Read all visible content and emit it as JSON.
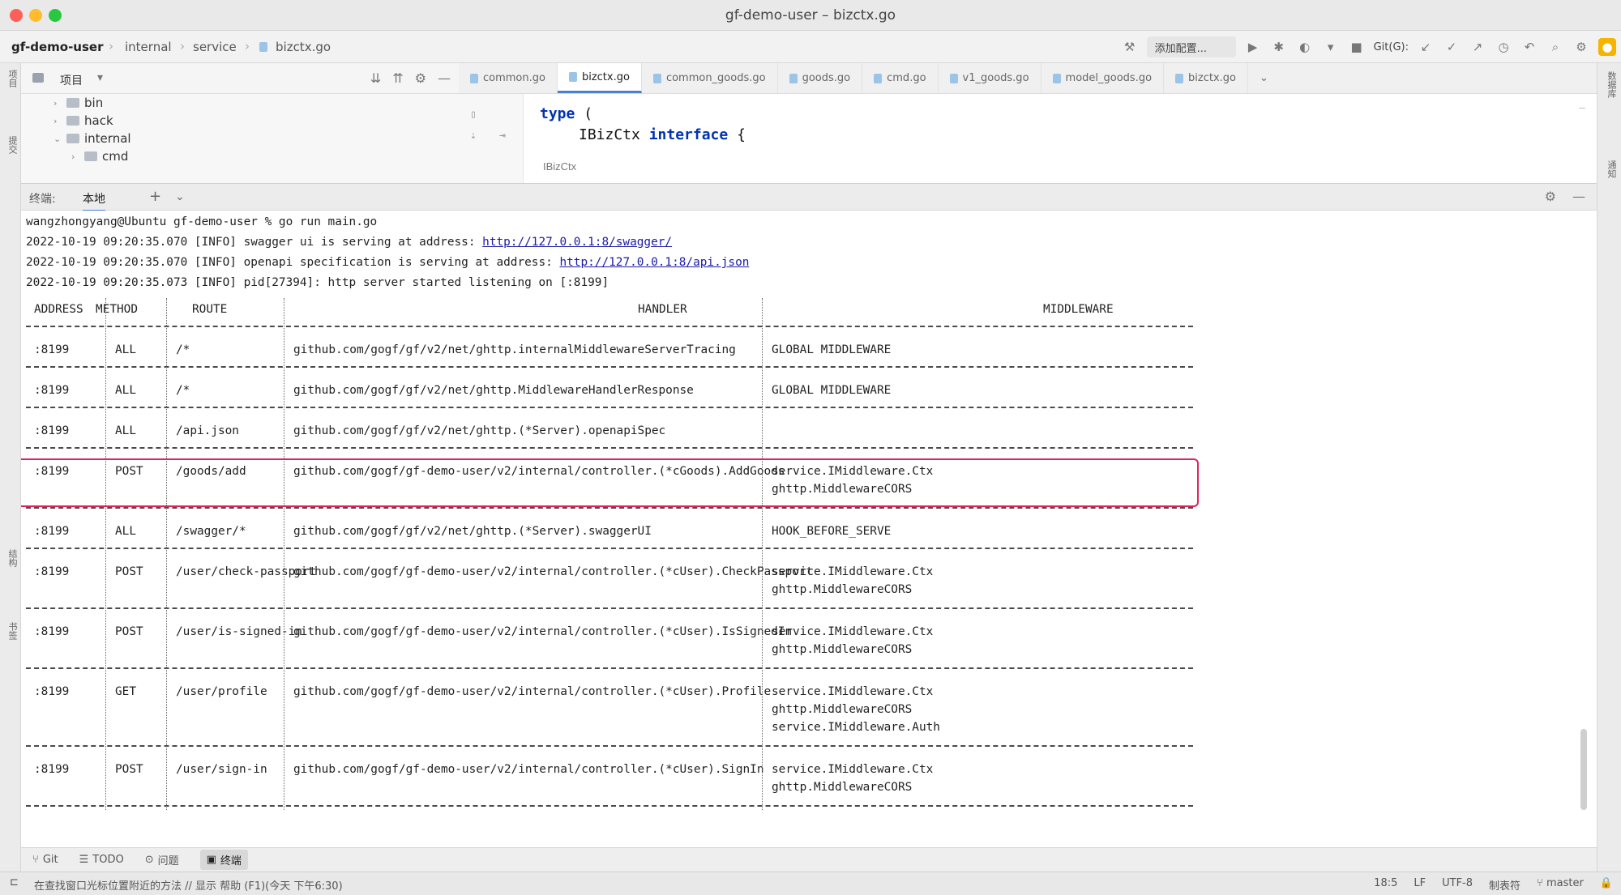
{
  "window": {
    "title": "gf-demo-user – bizctx.go"
  },
  "nav": {
    "breadcrumb": [
      "gf-demo-user",
      "internal",
      "service",
      "bizctx.go"
    ],
    "run_config": "添加配置...",
    "git_label": "Git(G):"
  },
  "project_pane": {
    "title": "项目"
  },
  "tabs": [
    {
      "label": "common.go"
    },
    {
      "label": "bizctx.go",
      "active": true
    },
    {
      "label": "common_goods.go"
    },
    {
      "label": "goods.go"
    },
    {
      "label": "cmd.go"
    },
    {
      "label": "v1_goods.go"
    },
    {
      "label": "model_goods.go"
    },
    {
      "label": "bizctx.go"
    }
  ],
  "tree": [
    {
      "label": "bin",
      "depth": 1,
      "expanded": false
    },
    {
      "label": "hack",
      "depth": 1,
      "expanded": false
    },
    {
      "label": "internal",
      "depth": 1,
      "expanded": true
    },
    {
      "label": "cmd",
      "depth": 2,
      "expanded": false
    }
  ],
  "editor": {
    "line1_kw": "type",
    "line1_rest": " (",
    "line2_name": "IBizCtx",
    "line2_kw": "interface",
    "line2_rest": " {",
    "breadcrumb": "IBizCtx"
  },
  "terminal_tabs": [
    "终端:",
    "本地"
  ],
  "terminal": {
    "prompt": "wangzhongyang@Ubuntu gf-demo-user % go run main.go",
    "log1_prefix": "2022-10-19 09:20:35.070 [INFO] swagger ui is serving at address: ",
    "log1_link": "http://127.0.0.1:8/swagger/",
    "log2_prefix": "2022-10-19 09:20:35.070 [INFO] openapi specification is serving at address: ",
    "log2_link": "http://127.0.0.1:8/api.json",
    "log3": "2022-10-19 09:20:35.073 [INFO] pid[27394]: http server started listening on [:8199]"
  },
  "route_table": {
    "headers": [
      "ADDRESS",
      "METHOD",
      "ROUTE",
      "HANDLER",
      "MIDDLEWARE"
    ],
    "rows": [
      {
        "address": ":8199",
        "method": "ALL",
        "route": "/*",
        "handler": "github.com/gogf/gf/v2/net/ghttp.internalMiddlewareServerTracing",
        "middleware": [
          "GLOBAL MIDDLEWARE"
        ]
      },
      {
        "address": ":8199",
        "method": "ALL",
        "route": "/*",
        "handler": "github.com/gogf/gf/v2/net/ghttp.MiddlewareHandlerResponse",
        "middleware": [
          "GLOBAL MIDDLEWARE"
        ]
      },
      {
        "address": ":8199",
        "method": "ALL",
        "route": "/api.json",
        "handler": "github.com/gogf/gf/v2/net/ghttp.(*Server).openapiSpec",
        "middleware": []
      },
      {
        "address": ":8199",
        "method": "POST",
        "route": "/goods/add",
        "handler": "github.com/gogf/gf-demo-user/v2/internal/controller.(*cGoods).AddGoods",
        "middleware": [
          "service.IMiddleware.Ctx",
          "ghttp.MiddlewareCORS"
        ],
        "highlight": true
      },
      {
        "address": ":8199",
        "method": "ALL",
        "route": "/swagger/*",
        "handler": "github.com/gogf/gf/v2/net/ghttp.(*Server).swaggerUI",
        "middleware": [
          "HOOK_BEFORE_SERVE"
        ]
      },
      {
        "address": ":8199",
        "method": "POST",
        "route": "/user/check-passport",
        "handler": "github.com/gogf/gf-demo-user/v2/internal/controller.(*cUser).CheckPassport",
        "middleware": [
          "service.IMiddleware.Ctx",
          "ghttp.MiddlewareCORS"
        ]
      },
      {
        "address": ":8199",
        "method": "POST",
        "route": "/user/is-signed-in",
        "handler": "github.com/gogf/gf-demo-user/v2/internal/controller.(*cUser).IsSignedIn",
        "middleware": [
          "service.IMiddleware.Ctx",
          "ghttp.MiddlewareCORS"
        ]
      },
      {
        "address": ":8199",
        "method": "GET",
        "route": "/user/profile",
        "handler": "github.com/gogf/gf-demo-user/v2/internal/controller.(*cUser).Profile",
        "middleware": [
          "service.IMiddleware.Ctx",
          "ghttp.MiddlewareCORS",
          "service.IMiddleware.Auth"
        ]
      },
      {
        "address": ":8199",
        "method": "POST",
        "route": "/user/sign-in",
        "handler": "github.com/gogf/gf-demo-user/v2/internal/controller.(*cUser).SignIn",
        "middleware": [
          "service.IMiddleware.Ctx",
          "ghttp.MiddlewareCORS"
        ]
      }
    ]
  },
  "bottom_tools": [
    {
      "label": "Git",
      "icon": "git-branch-icon"
    },
    {
      "label": "TODO",
      "icon": "todo-list-icon"
    },
    {
      "label": "问题",
      "icon": "problems-icon"
    },
    {
      "label": "终端",
      "icon": "terminal-icon",
      "active": true
    }
  ],
  "status": {
    "message": "在查找窗口光标位置附近的方法 // 显示 帮助 (F1)(今天 下午6:30)",
    "position": "18:5",
    "encoding": "UTF-8",
    "indent": "制表符",
    "branch": "master",
    "lf": "LF"
  },
  "colors": {
    "highlight_box": "#e0245e",
    "link": "#1a1aa6",
    "active_tab": "#4a7fd6"
  }
}
